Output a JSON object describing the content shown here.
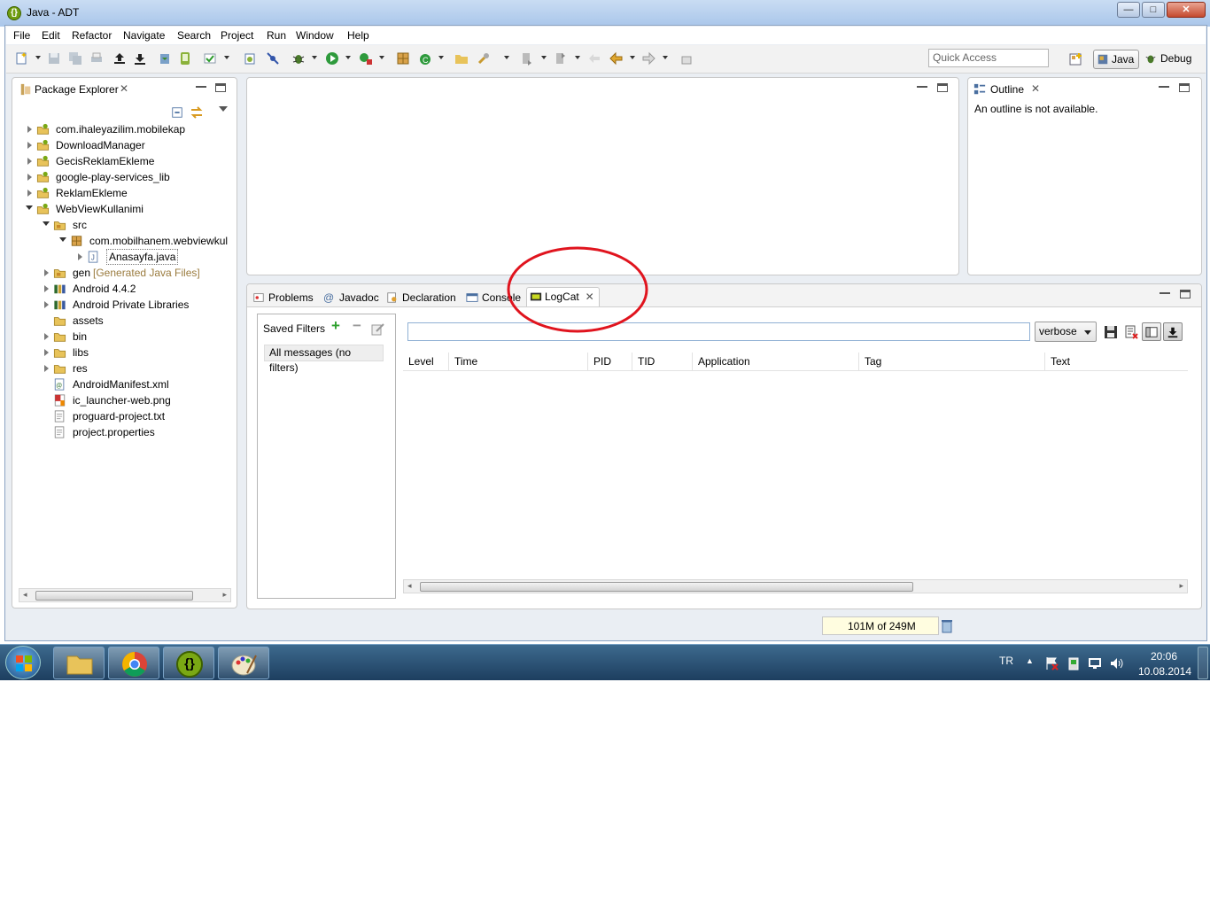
{
  "window": {
    "title": "Java - ADT",
    "app_icon": "adt-icon"
  },
  "window_buttons": {
    "minimize": "—",
    "maximize": "□",
    "close": "✕"
  },
  "menubar": {
    "items": [
      "File",
      "Edit",
      "Refactor",
      "Navigate",
      "Search",
      "Project",
      "Run",
      "Window",
      "Help"
    ]
  },
  "toolbar": {
    "quick_access_placeholder": "Quick Access"
  },
  "perspectives": {
    "java": "Java",
    "debug": "Debug"
  },
  "package_explorer": {
    "title": "Package Explorer",
    "tree": [
      {
        "label": "com.ihaleyazilim.mobilekap",
        "icon": "android-project-icon",
        "expanded": false
      },
      {
        "label": "DownloadManager",
        "icon": "android-project-icon",
        "expanded": false
      },
      {
        "label": "GecisReklamEkleme",
        "icon": "android-project-icon",
        "expanded": false
      },
      {
        "label": "google-play-services_lib",
        "icon": "android-project-icon",
        "expanded": false
      },
      {
        "label": "ReklamEkleme",
        "icon": "android-project-icon",
        "expanded": false
      },
      {
        "label": "WebViewKullanimi",
        "icon": "android-project-icon",
        "expanded": true
      },
      {
        "label": "src",
        "icon": "source-folder-icon",
        "expanded": true
      },
      {
        "label": "com.mobilhanem.webviewkul",
        "icon": "package-icon",
        "expanded": true
      },
      {
        "label": "Anasayfa.java",
        "icon": "java-file-icon",
        "expanded": false
      },
      {
        "label": "gen",
        "suffix": "[Generated Java Files]",
        "icon": "source-folder-icon",
        "expanded": false
      },
      {
        "label": "Android 4.4.2",
        "icon": "library-icon",
        "expanded": false
      },
      {
        "label": "Android Private Libraries",
        "icon": "library-icon",
        "expanded": false
      },
      {
        "label": "assets",
        "icon": "folder-icon",
        "expanded": false
      },
      {
        "label": "bin",
        "icon": "folder-icon",
        "expanded": false
      },
      {
        "label": "libs",
        "icon": "folder-icon",
        "expanded": false
      },
      {
        "label": "res",
        "icon": "folder-icon",
        "expanded": false
      },
      {
        "label": "AndroidManifest.xml",
        "icon": "xml-file-icon",
        "expanded": false
      },
      {
        "label": "ic_launcher-web.png",
        "icon": "image-file-icon",
        "expanded": false
      },
      {
        "label": "proguard-project.txt",
        "icon": "text-file-icon",
        "expanded": false
      },
      {
        "label": "project.properties",
        "icon": "text-file-icon",
        "expanded": false
      }
    ]
  },
  "outline": {
    "title": "Outline",
    "message": "An outline is not available."
  },
  "bottom_tabs": [
    "Problems",
    "Javadoc",
    "Declaration",
    "Console",
    "LogCat"
  ],
  "logcat": {
    "saved_filters_label": "Saved Filters",
    "filter_item": "All messages (no filters)",
    "search_value": "",
    "level_select": "verbose",
    "columns": [
      "Level",
      "Time",
      "PID",
      "TID",
      "Application",
      "Tag",
      "Text"
    ]
  },
  "status": {
    "heap": "101M of 249M"
  },
  "taskbar": {
    "apps": [
      "windows-explorer-icon",
      "chrome-icon",
      "adt-icon",
      "paint-icon"
    ],
    "lang": "TR",
    "time": "20:06",
    "date": "10.08.2014"
  },
  "colors": {
    "annotation_circle": "#e0141e",
    "accent": "#3a6ea5",
    "gen_label": "#9a7b3e"
  }
}
